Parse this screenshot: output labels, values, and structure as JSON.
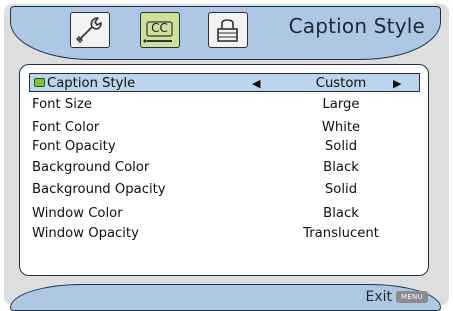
{
  "header": {
    "title": "Caption Style",
    "tabs": [
      {
        "icon": "wrench-icon",
        "label": "",
        "active": false
      },
      {
        "icon": "cc-icon",
        "label": "CC",
        "active": true
      },
      {
        "icon": "lock-icon",
        "label": "",
        "active": false
      }
    ]
  },
  "menu": {
    "items": [
      {
        "label": "Caption Style",
        "value": "Custom",
        "selected": true
      },
      {
        "label": "Font Size",
        "value": "Large"
      },
      {
        "label": "Font Color",
        "value": "White"
      },
      {
        "label": "Font Opacity",
        "value": "Solid"
      },
      {
        "label": "Background Color",
        "value": "Black"
      },
      {
        "label": "Background Opacity",
        "value": "Solid"
      },
      {
        "label": "Window Color",
        "value": "Black"
      },
      {
        "label": "Window Opacity",
        "value": "Translucent"
      }
    ],
    "arrow_left": "◀",
    "arrow_right": "▶"
  },
  "footer": {
    "exit_label": "Exit",
    "menu_key_label": "MENU"
  },
  "colors": {
    "bar": "#aec8e4",
    "highlight": "#bcd4ec",
    "active_tab": "#cfe09a"
  }
}
